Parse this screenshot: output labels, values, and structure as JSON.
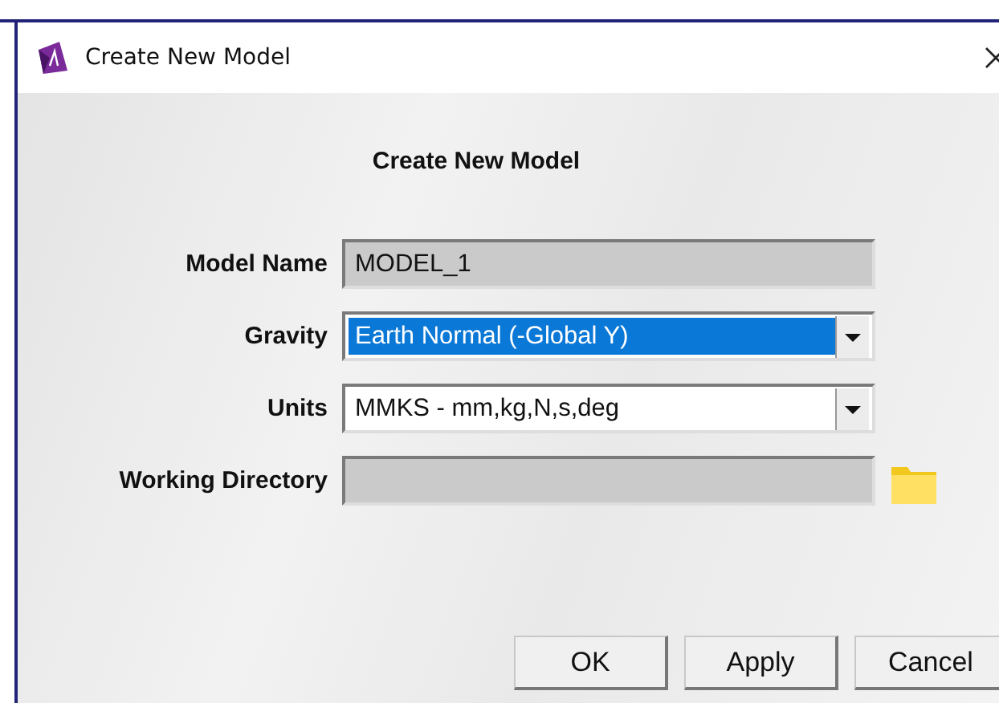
{
  "window": {
    "title": "Create New Model"
  },
  "heading": "Create New Model",
  "fields": [
    {
      "label": "Model Name",
      "kind": "text",
      "value": "MODEL_1",
      "disabled": true
    },
    {
      "label": "Gravity",
      "kind": "dropdown",
      "value": "Earth Normal (-Global Y)",
      "highlighted": true
    },
    {
      "label": "Units",
      "kind": "dropdown",
      "value": "MMKS - mm,kg,N,s,deg",
      "highlighted": false
    },
    {
      "label": "Working Directory",
      "kind": "folder",
      "disabled": true
    }
  ],
  "buttons": [
    "OK",
    "Apply",
    "Cancel"
  ]
}
